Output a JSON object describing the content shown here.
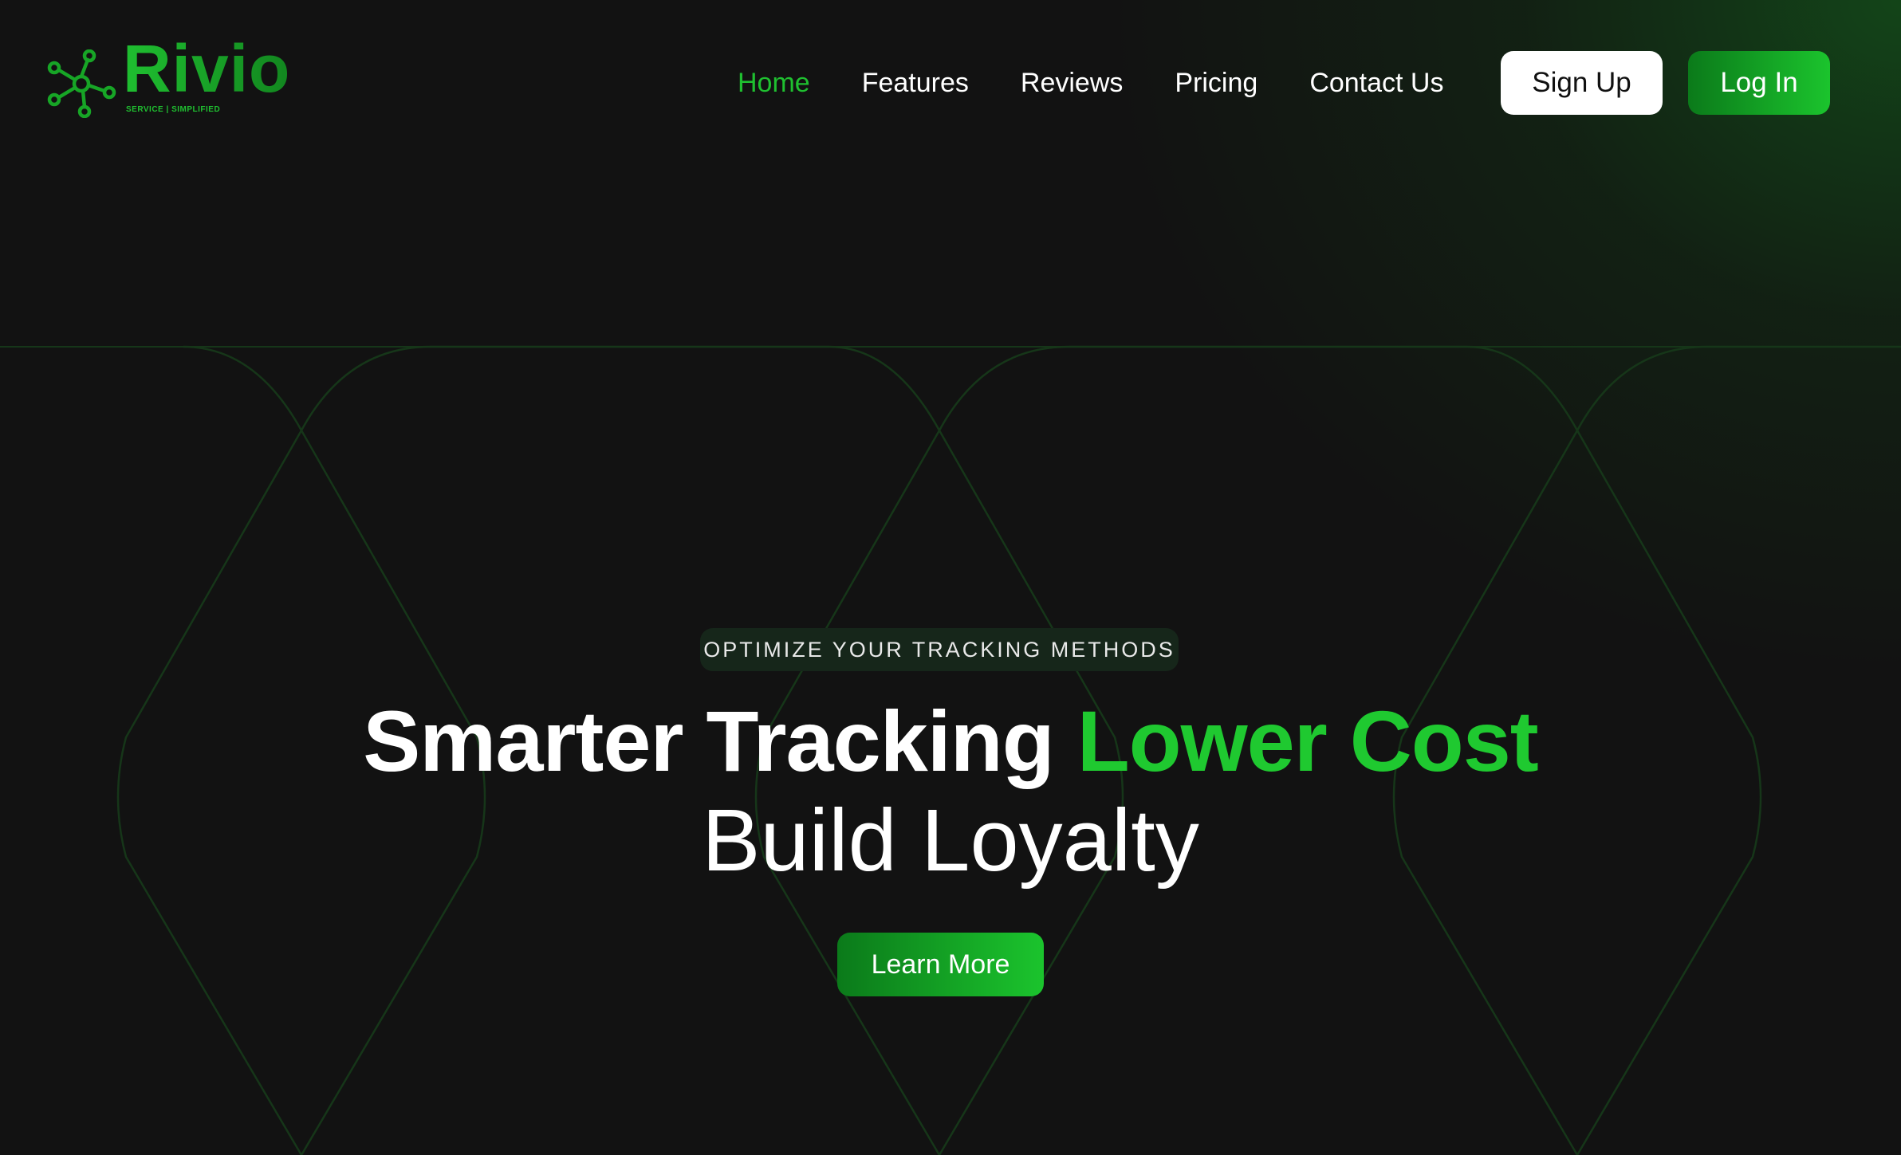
{
  "brand": {
    "name": "Rivio",
    "tagline": "SERVICE | SIMPLIFIED",
    "logo_icon": "molecule-network-icon"
  },
  "nav": {
    "links": [
      {
        "label": "Home",
        "active": true
      },
      {
        "label": "Features",
        "active": false
      },
      {
        "label": "Reviews",
        "active": false
      },
      {
        "label": "Pricing",
        "active": false
      },
      {
        "label": "Contact Us",
        "active": false
      }
    ],
    "signup_label": "Sign Up",
    "login_label": "Log In"
  },
  "hero": {
    "eyebrow": "OPTIMIZE YOUR TRACKING METHODS",
    "headline_white": "Smarter Tracking",
    "headline_green": "Lower Cost",
    "subheadline": "Build Loyalty",
    "cta_label": "Learn More"
  },
  "colors": {
    "background": "#121212",
    "accent": "#1fc930",
    "accent_dark": "#0b7a1a",
    "text": "#ffffff"
  }
}
